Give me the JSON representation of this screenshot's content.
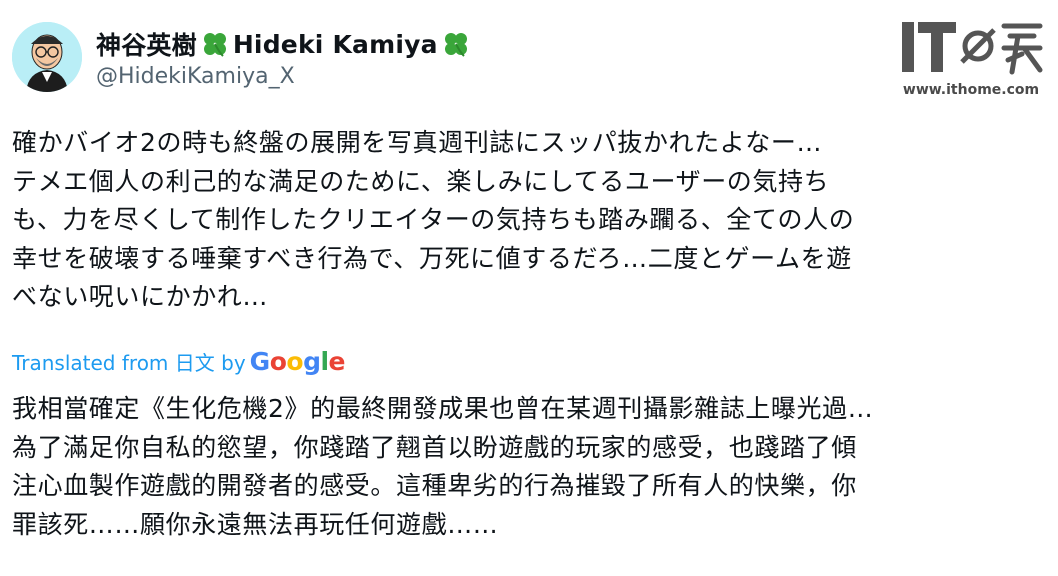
{
  "author": {
    "display_name_ja": "神谷英樹",
    "display_name_en": "Hideki Kamiya",
    "handle": "@HidekiKamiya_X",
    "badge_icon": "four-leaf-clover-icon",
    "badge_color": "#3aa63a",
    "avatar_bg": "#b9eef6"
  },
  "watermark": {
    "logo_text": "IT之家",
    "url": "www.ithome.com"
  },
  "tweet": {
    "lines": [
      "確かバイオ2の時も終盤の展開を写真週刊誌にスッパ抜かれたよなー…",
      "テメエ個人の利己的な満足のために、楽しみにしてるユーザーの気持ち",
      "も、力を尽くして制作したクリエイターの気持ちも踏み躙る、全ての人の",
      "幸せを破壊する唾棄すべき行為で、万死に値するだろ…二度とゲームを遊",
      "べない呪いにかかれ…"
    ]
  },
  "translation": {
    "label_prefix": "Translated from 日文 by",
    "provider": "Google",
    "provider_colors": [
      "#4285f4",
      "#ea4335",
      "#fbbc05",
      "#4285f4",
      "#34a853",
      "#ea4335"
    ],
    "label_color": "#1d9bf0",
    "lines": [
      "我相當確定《生化危機2》的最終開發成果也曾在某週刊攝影雜誌上曝光過…",
      "為了滿足你自私的慾望，你踐踏了翹首以盼遊戲的玩家的感受，也踐踏了傾",
      "注心血製作遊戲的開發者的感受。這種卑劣的行為摧毀了所有人的快樂，你",
      "罪該死……願你永遠無法再玩任何遊戲……"
    ]
  }
}
